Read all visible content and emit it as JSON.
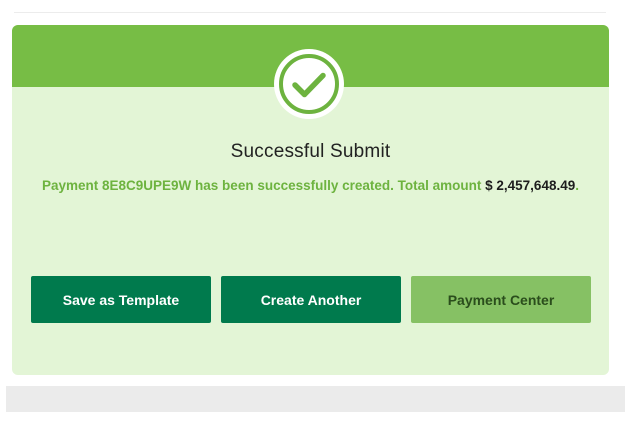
{
  "colors": {
    "header_green": "#77bd45",
    "card_background": "#e3f5d6",
    "primary_button": "#007a4d",
    "secondary_button": "#86c164",
    "message_text": "#6db33f"
  },
  "success": {
    "icon": "check-circle-icon",
    "title": "Successful Submit",
    "message_prefix": "Payment 8E8C9UPE9W has been successfully created. Total amount ",
    "amount": "$ 2,457,648.49",
    "message_suffix": "."
  },
  "actions": {
    "save_template": "Save as Template",
    "create_another": "Create Another",
    "payment_center": "Payment Center"
  }
}
